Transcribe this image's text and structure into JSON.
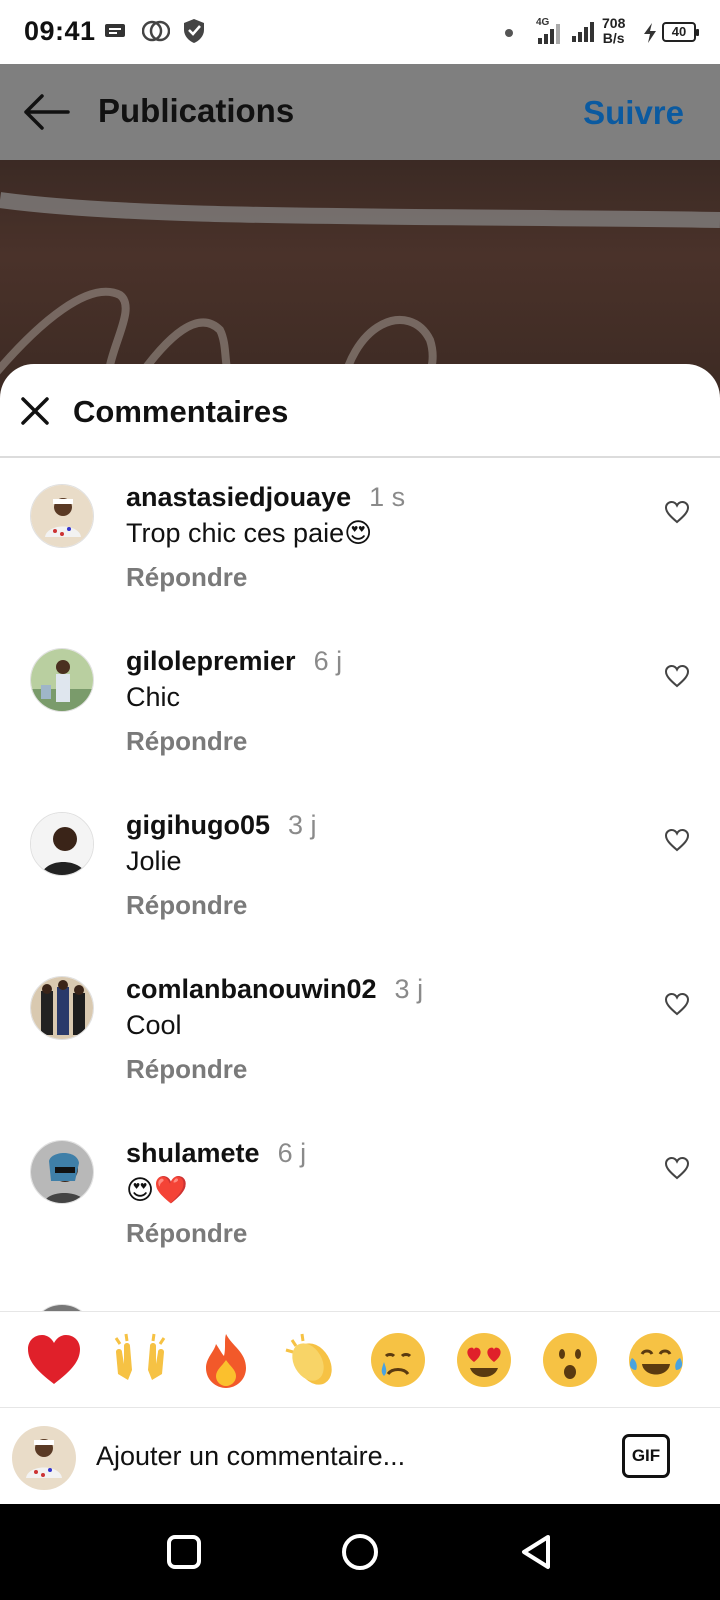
{
  "status_bar": {
    "time": "09:41",
    "network_type": "4G",
    "speed_value": "708",
    "speed_unit": "B/s",
    "battery": "40"
  },
  "header": {
    "title": "Publications",
    "follow_label": "Suivre"
  },
  "sheet": {
    "title": "Commentaires"
  },
  "comments": [
    {
      "user": "anastasiedjouaye",
      "time": "1 s",
      "text": "Trop chic ces paie😍",
      "reply": "Répondre"
    },
    {
      "user": "gilolepremier",
      "time": "6 j",
      "text": "Chic",
      "reply": "Répondre"
    },
    {
      "user": "gigihugo05",
      "time": "3 j",
      "text": "Jolie",
      "reply": "Répondre"
    },
    {
      "user": "comlanbanouwin02",
      "time": "3 j",
      "text": "Cool",
      "reply": "Répondre"
    },
    {
      "user": "shulamete",
      "time": "6 j",
      "text": "😍❤️",
      "reply": "Répondre"
    }
  ],
  "emoji_bar": [
    "❤️",
    "🙌",
    "🔥",
    "👏",
    "😢",
    "😍",
    "😮",
    "😂"
  ],
  "input": {
    "placeholder": "Ajouter un commentaire...",
    "gif_label": "GIF"
  },
  "colors": {
    "accent_link": "#0b5aa0",
    "dim_overlay": "#7f7f7f",
    "like_red": "#e0202a"
  }
}
